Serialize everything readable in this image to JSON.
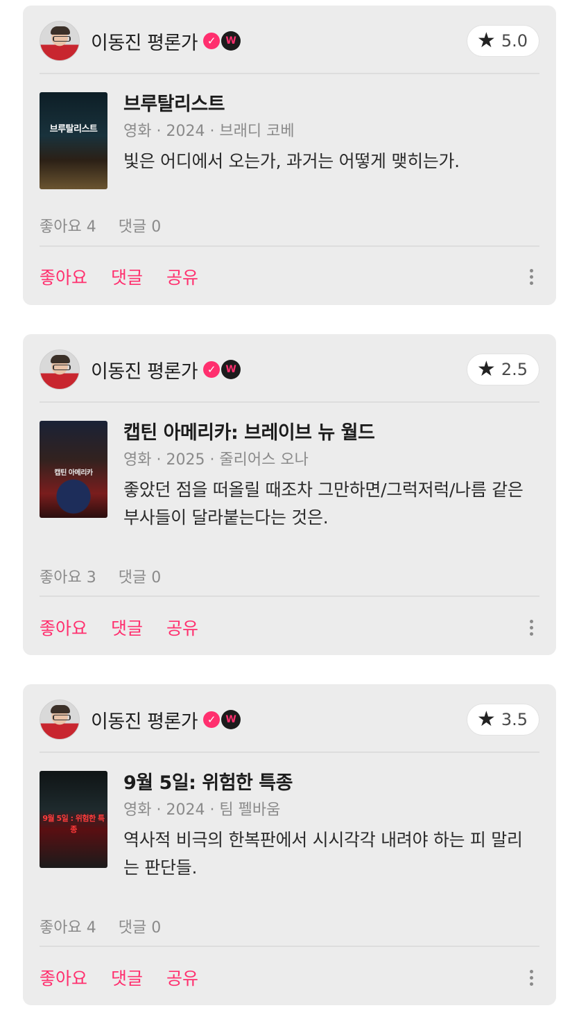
{
  "reviews": [
    {
      "author": "이동진 평론가",
      "verified_icon": "check-badge-icon",
      "watcha_icon": "w-badge-icon",
      "rating": "5.0",
      "poster_text": "브루탈리스트",
      "title": "브루탈리스트",
      "meta": "영화 · 2024 · 브래디 코베",
      "review": "빛은 어디에서 오는가, 과거는 어떻게 맺히는가.",
      "likes": "좋아요 4",
      "comments": "댓글 0",
      "like_action": "좋아요",
      "comment_action": "댓글",
      "share_action": "공유"
    },
    {
      "author": "이동진 평론가",
      "verified_icon": "check-badge-icon",
      "watcha_icon": "w-badge-icon",
      "rating": "2.5",
      "poster_text": "캡틴 아메리카",
      "title": "캡틴 아메리카: 브레이브 뉴 월드",
      "meta": "영화 · 2025 · 줄리어스 오나",
      "review": "좋았던 점을 떠올릴 때조차 그만하면/그럭저럭/나름 같은 부사들이 달라붙는다는 것은.",
      "likes": "좋아요 3",
      "comments": "댓글 0",
      "like_action": "좋아요",
      "comment_action": "댓글",
      "share_action": "공유"
    },
    {
      "author": "이동진 평론가",
      "verified_icon": "check-badge-icon",
      "watcha_icon": "w-badge-icon",
      "rating": "3.5",
      "poster_text": "9월 5일 : 위험한 특종",
      "title": "9월 5일: 위험한 특종",
      "meta": "영화 · 2024 · 팀 펠바움",
      "review": "역사적 비극의 한복판에서 시시각각 내려야 하는 피 말리는 판단들.",
      "likes": "좋아요 4",
      "comments": "댓글 0",
      "like_action": "좋아요",
      "comment_action": "댓글",
      "share_action": "공유"
    }
  ],
  "colors": {
    "accent": "#ff2f6e",
    "card_bg": "#ececec",
    "muted": "#8a8a8a"
  }
}
